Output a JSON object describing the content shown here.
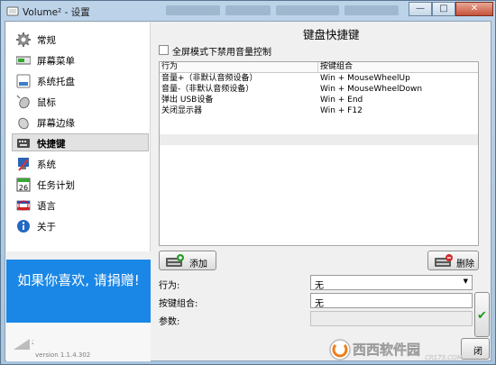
{
  "window": {
    "title": "Volume² - 设置",
    "close_glyph": "✕",
    "minimize_glyph": "—",
    "maximize_glyph": "□"
  },
  "sidebar": {
    "items": [
      {
        "label": "常规",
        "icon": "gear-icon"
      },
      {
        "label": "屏幕菜单",
        "icon": "screen-menu-icon"
      },
      {
        "label": "系统托盘",
        "icon": "system-tray-icon"
      },
      {
        "label": "鼠标",
        "icon": "mouse-icon"
      },
      {
        "label": "屏幕边缘",
        "icon": "screen-edge-icon"
      },
      {
        "label": "快捷键",
        "icon": "keyboard-icon",
        "active": true
      },
      {
        "label": "系统",
        "icon": "system-icon"
      },
      {
        "label": "任务计划",
        "icon": "calendar-icon"
      },
      {
        "label": "语言",
        "icon": "language-flag-icon"
      },
      {
        "label": "关于",
        "icon": "info-icon"
      }
    ],
    "promo": "如果你喜欢, 请捐赠!",
    "version": "version 1.1.4.302",
    "vol_number": "2"
  },
  "main": {
    "title": "键盘快捷键",
    "fullscreen_checkbox": "全屏模式下禁用音量控制",
    "table": {
      "headers": [
        "行为",
        "按键组合"
      ],
      "rows": [
        [
          "音量+（非默认音频设备）",
          "Win + MouseWheelUp"
        ],
        [
          "音量-（非默认音频设备）",
          "Win + MouseWheelDown"
        ],
        [
          "弹出 USB设备",
          "Win + End"
        ],
        [
          "关闭显示器",
          "Win + F12"
        ]
      ]
    },
    "add_button": "添加",
    "delete_button": "删除",
    "form": {
      "action_label": "行为:",
      "action_value": "无",
      "combo_label": "按键组合:",
      "combo_value": "无",
      "params_label": "参数:",
      "params_value": ""
    },
    "close_button": "闭"
  },
  "watermark": {
    "text1": "西西软件园",
    "text2": "CR173.COM"
  },
  "colors": {
    "promo_bg": "#1a87e6",
    "ok_check": "#1b9a1b"
  }
}
